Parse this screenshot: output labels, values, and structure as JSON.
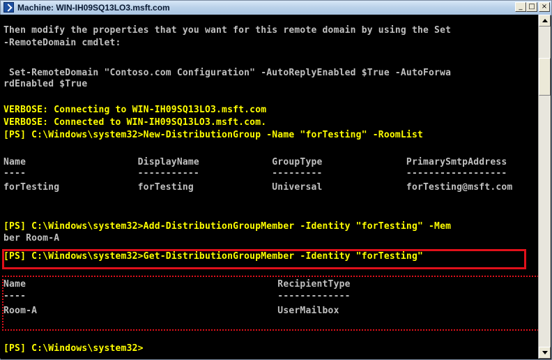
{
  "window": {
    "title": "Machine: WIN-IH09SQ13LO3.msft.com"
  },
  "controls": {
    "minimize": "_",
    "maximize": "□",
    "close": "×"
  },
  "console": {
    "lines": [
      "Then modify the properties that you want for this remote domain by using the Set",
      "-RemoteDomain cmdlet:",
      "",
      " Set-RemoteDomain \"Contoso.com Configuration\" -AutoReplyEnabled $True -AutoForwa",
      "rdEnabled $True",
      "",
      "VERBOSE: Connecting to WIN-IH09SQ13LO3.msft.com",
      "VERBOSE: Connected to WIN-IH09SQ13LO3.msft.com.",
      "[PS] C:\\Windows\\system32>New-DistributionGroup -Name \"forTesting\" -RoomList",
      "",
      "Name                    DisplayName             GroupType               PrimarySmtpAddress",
      "----                    -----------             ---------               ------------------",
      "forTesting              forTesting              Universal               forTesting@msft.com",
      "",
      "",
      "[PS] C:\\Windows\\system32>Add-DistributionGroupMember -Identity \"forTesting\" -Mem",
      "ber Room-A",
      "[PS] C:\\Windows\\system32>Get-DistributionGroupMember -Identity \"forTesting\"",
      "",
      "Name                                             RecipientType",
      "----                                             -------------",
      "Room-A                                           UserMailbox",
      "",
      "",
      "[PS] C:\\Windows\\system32>"
    ]
  }
}
